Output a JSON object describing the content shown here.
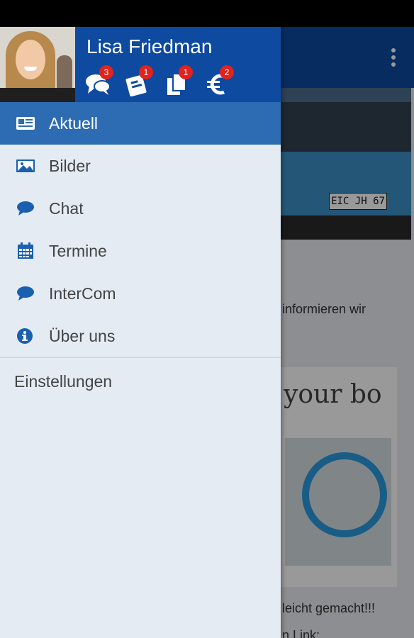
{
  "user": {
    "name": "Lisa Friedman"
  },
  "header_icons": [
    {
      "name": "chat-bubbles-icon",
      "badge": "3"
    },
    {
      "name": "coupon-icon",
      "badge": "1"
    },
    {
      "name": "documents-icon",
      "badge": "1"
    },
    {
      "name": "euro-icon",
      "badge": "2"
    }
  ],
  "menu": {
    "items": [
      {
        "label": "Aktuell",
        "icon": "newspaper-icon",
        "active": true
      },
      {
        "label": "Bilder",
        "icon": "image-icon"
      },
      {
        "label": "Chat",
        "icon": "chat-icon"
      },
      {
        "label": "Termine",
        "icon": "calendar-icon"
      },
      {
        "label": "InterCom",
        "icon": "chat-icon"
      },
      {
        "label": "Über uns",
        "icon": "info-icon"
      }
    ],
    "settings_label": "Einstellungen"
  },
  "background": {
    "plate": "EIC JH 67",
    "text_1": "informieren wir",
    "script_text": "your bo",
    "text_2": "leicht gemacht!!!",
    "text_3": "n Link:"
  },
  "colors": {
    "brand": "#0d4aa0",
    "active": "#2d6cb3",
    "badge": "#e0231e",
    "drawer_bg": "#e4ebf3"
  }
}
